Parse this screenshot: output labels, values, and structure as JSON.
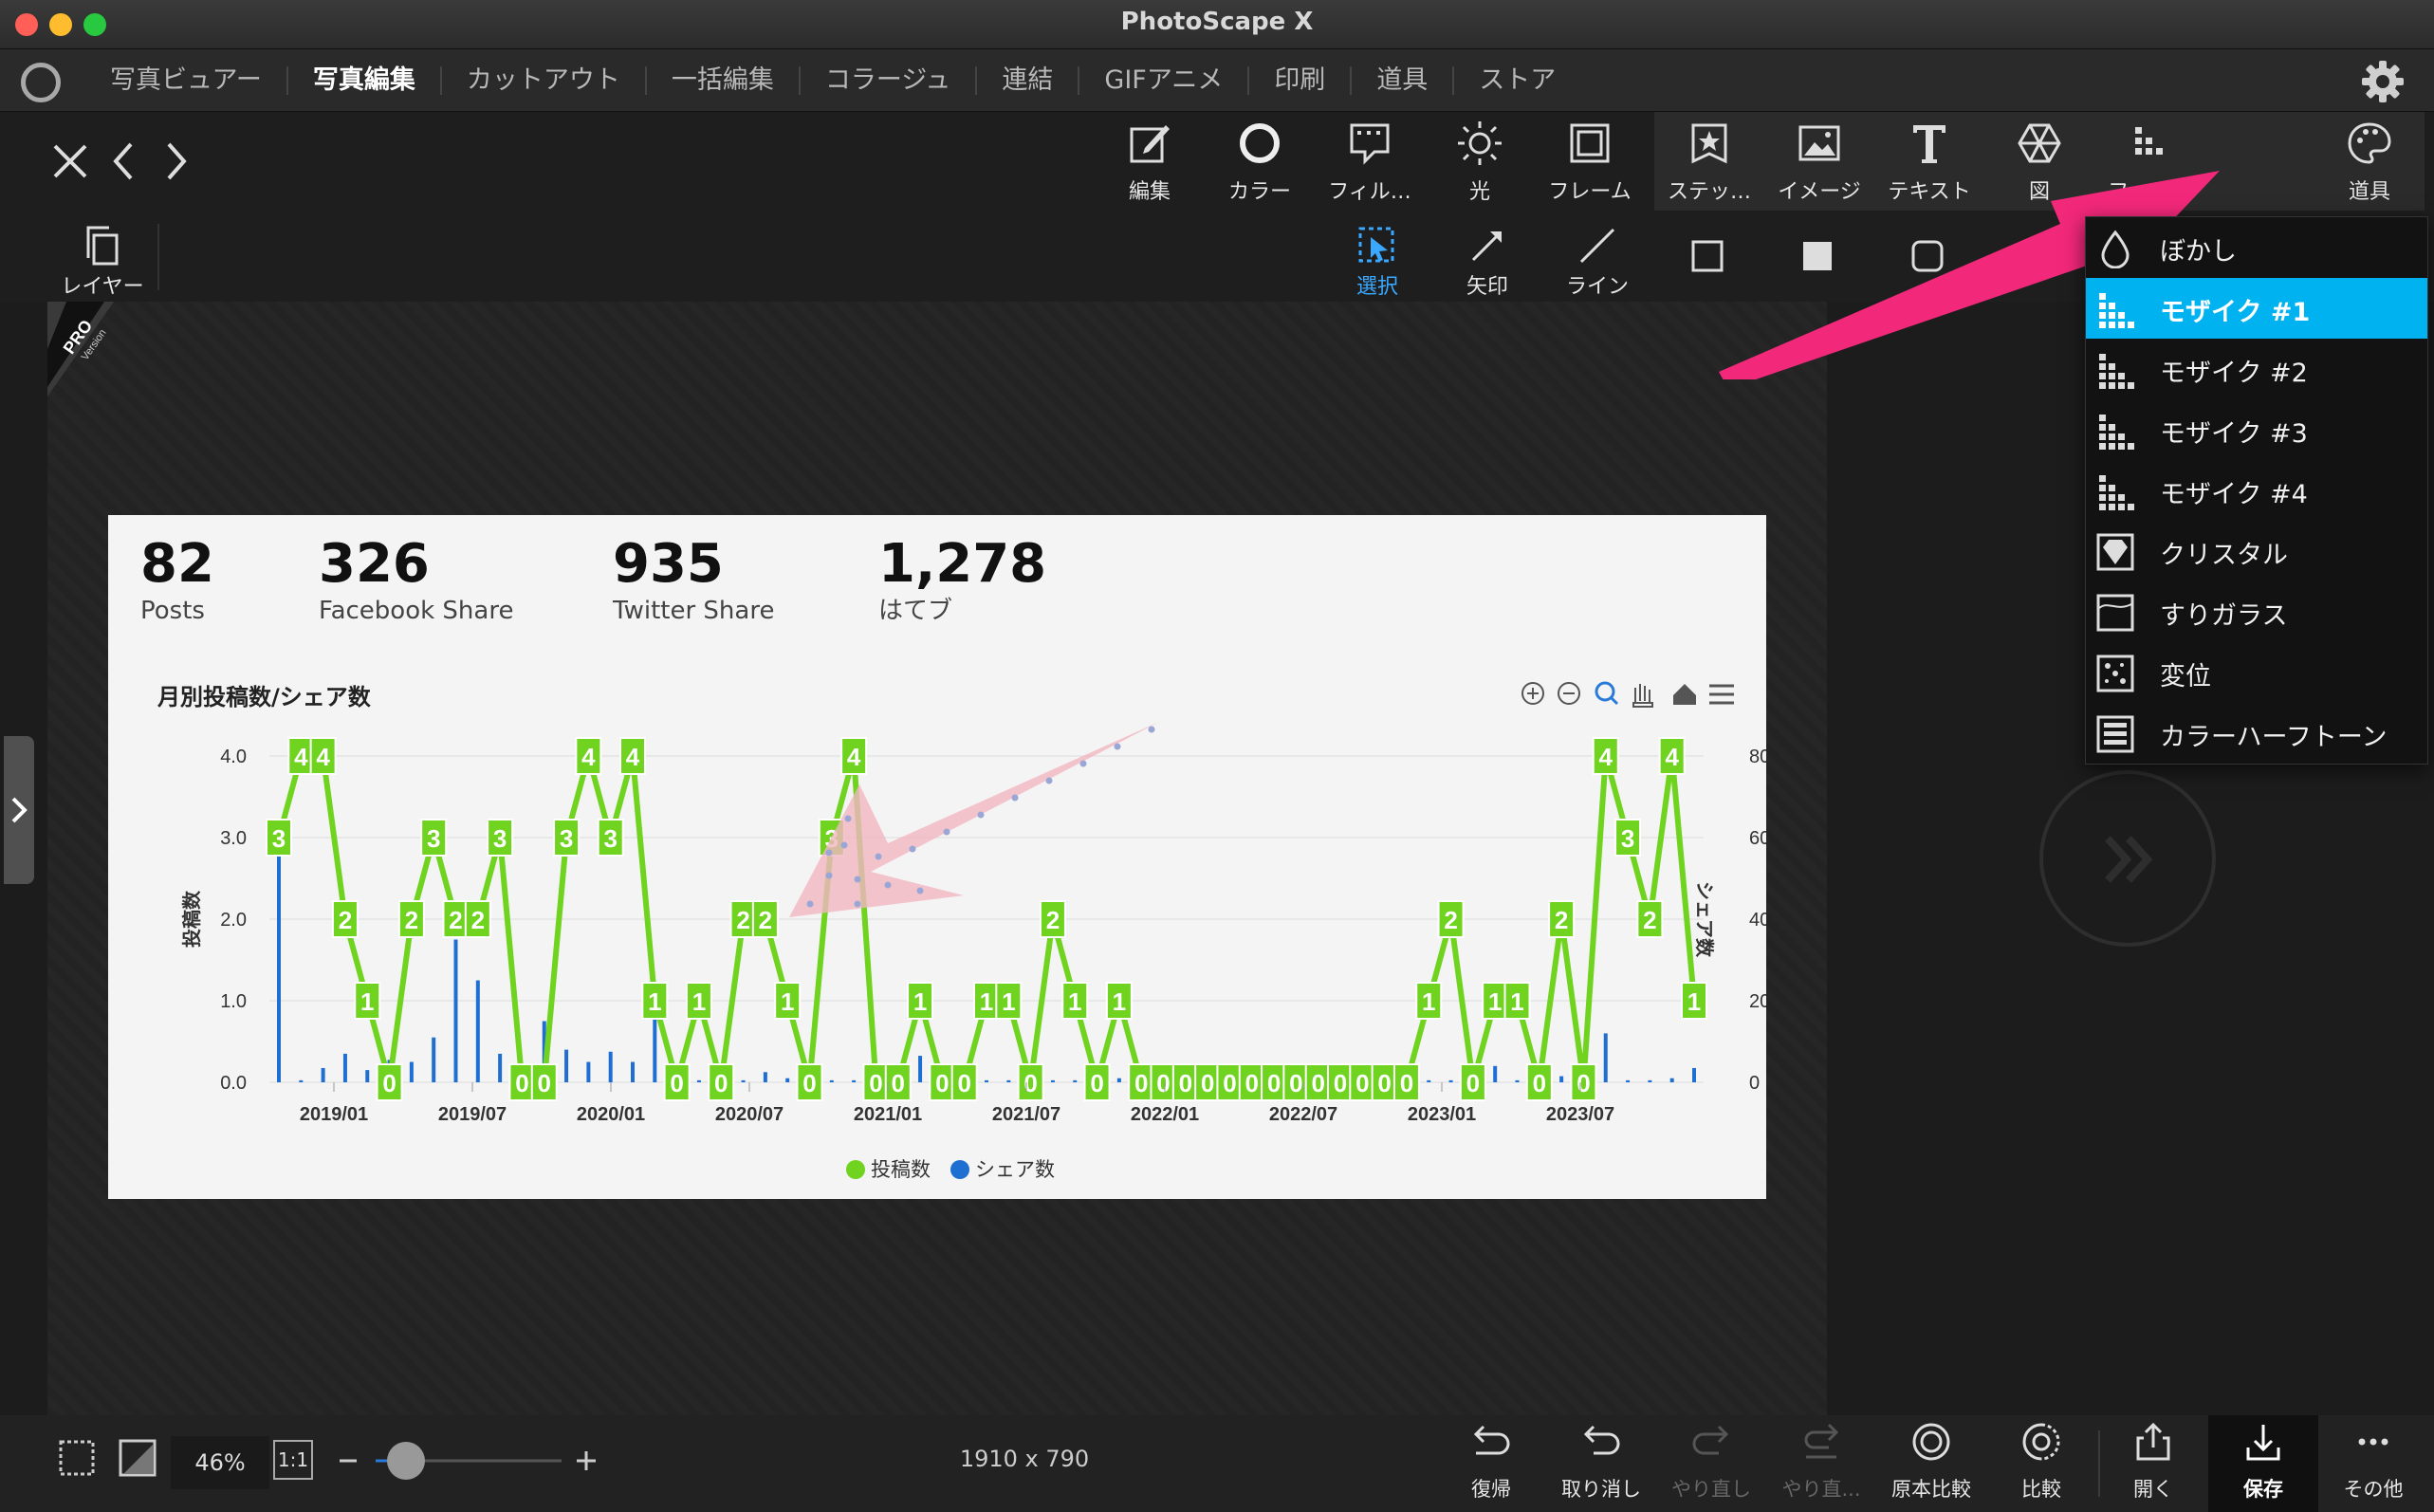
{
  "window": {
    "title": "PhotoScape X"
  },
  "menu": {
    "items": [
      "写真ビュアー",
      "写真編集",
      "カットアウト",
      "一括編集",
      "コラージュ",
      "連結",
      "GIFアニメ",
      "印刷",
      "道具",
      "ストア"
    ],
    "active": "写真編集"
  },
  "toolbar": {
    "tools": [
      "編集",
      "カラー",
      "フィル…",
      "光",
      "フレーム"
    ],
    "tools2": [
      "ステッ…",
      "イメージ",
      "テキスト",
      "図",
      "フィル…",
      "道具"
    ]
  },
  "subtoolbar": {
    "layer": "レイヤー",
    "tools": [
      "選択",
      "矢印",
      "ライン"
    ]
  },
  "dropdown": {
    "items": [
      "ぼかし",
      "モザイク #1",
      "モザイク #2",
      "モザイク #3",
      "モザイク #4",
      "クリスタル",
      "すりガラス",
      "変位",
      "カラーハーフトーン"
    ],
    "selected": "モザイク #1"
  },
  "pro_badge": {
    "line1": "PRO",
    "line2": "Version"
  },
  "photo": {
    "stats": [
      {
        "value": "82",
        "label": "Posts"
      },
      {
        "value": "326",
        "label": "Facebook Share"
      },
      {
        "value": "935",
        "label": "Twitter Share"
      },
      {
        "value": "1,278",
        "label": "はてブ"
      }
    ],
    "chart_title": "月別投稿数/シェア数"
  },
  "chart_data": {
    "type": "line",
    "title": "月別投稿数/シェア数",
    "ylabel": "投稿数",
    "y2label": "シェア数",
    "ylim": [
      0,
      4
    ],
    "y2lim": [
      0,
      800
    ],
    "yticks": [
      "4.0",
      "3.0",
      "2.0",
      "1.0",
      "0.0"
    ],
    "y2ticks": [
      "800",
      "600",
      "400",
      "200",
      "0"
    ],
    "xticks": [
      "2019/01",
      "2019/07",
      "2020/01",
      "2020/07",
      "2021/01",
      "2021/07",
      "2022/01",
      "2022/07",
      "2023/01",
      "2023/07"
    ],
    "series": [
      {
        "name": "投稿数",
        "color": "#6fd31f",
        "type": "line",
        "values": [
          3,
          4,
          4,
          2,
          1,
          0,
          2,
          3,
          2,
          2,
          3,
          0,
          0,
          3,
          4,
          3,
          4,
          1,
          0,
          1,
          0,
          2,
          2,
          1,
          0,
          3,
          4,
          0,
          0,
          1,
          0,
          0,
          1,
          1,
          0,
          2,
          1,
          0,
          1,
          0,
          0,
          0,
          0,
          0,
          0,
          0,
          0,
          0,
          0,
          0,
          0,
          0,
          1,
          2,
          0,
          1,
          1,
          0,
          2,
          0,
          4,
          3,
          2,
          4,
          1
        ]
      },
      {
        "name": "シェア数",
        "color": "#1f6fd3",
        "type": "bar",
        "values": [
          560,
          5,
          35,
          70,
          30,
          55,
          50,
          110,
          350,
          250,
          70,
          30,
          150,
          80,
          50,
          75,
          50,
          155,
          10,
          5,
          15,
          5,
          25,
          10,
          15,
          5,
          5,
          10,
          5,
          65,
          20,
          5,
          5,
          5,
          25,
          5,
          5,
          15,
          10,
          10,
          5,
          5,
          5,
          5,
          5,
          5,
          5,
          5,
          5,
          5,
          5,
          5,
          5,
          5,
          15,
          40,
          5,
          15,
          15,
          55,
          120,
          5,
          5,
          10,
          35
        ]
      }
    ]
  },
  "bottombar": {
    "zoom": "46%",
    "ratio": "1:1",
    "image_size": "1910 x 790",
    "tools": [
      "復帰",
      "取り消し",
      "やり直し",
      "やり直...",
      "原本比較",
      "比較",
      "開く",
      "保存",
      "その他"
    ]
  }
}
